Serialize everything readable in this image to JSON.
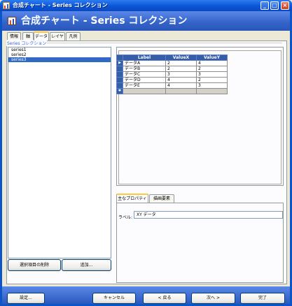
{
  "window": {
    "title": "合成チャート - Series コレクション"
  },
  "header": {
    "title": "合成チャート - Series コレクション"
  },
  "tabs": [
    {
      "label": "情報"
    },
    {
      "label": "軸"
    },
    {
      "label": "データ"
    },
    {
      "label": "レイヤ"
    },
    {
      "label": "凡例"
    }
  ],
  "group": {
    "label": "Series コレクション"
  },
  "series_list": [
    "series1",
    "series2",
    "series3"
  ],
  "series_selected": "series3",
  "series_buttons": {
    "delete": "選択項目の削除",
    "add": "追加..."
  },
  "grid": {
    "headers": [
      "Label",
      "ValueX",
      "ValueY"
    ],
    "rows": [
      [
        "データA",
        "2",
        "4"
      ],
      [
        "データB",
        "2",
        "2"
      ],
      [
        "データC",
        "3",
        "3"
      ],
      [
        "データD",
        "4",
        "2"
      ],
      [
        "データE",
        "4",
        "3"
      ]
    ],
    "current_row_marker": "▶",
    "new_row_marker": "✱"
  },
  "prop_tabs": [
    {
      "label": "主なプロパティ"
    },
    {
      "label": "描画要素"
    }
  ],
  "properties": {
    "label_caption": "ラベル:",
    "label_value": "XY データ"
  },
  "footer": {
    "settings": "設定...",
    "cancel": "キャンセル",
    "back": "< 戻る",
    "next": "次へ >",
    "finish": "完了"
  },
  "colors": {
    "title": "#0a56d6",
    "header_band": "#3362c9",
    "grid_header": "#345ea8",
    "selection": "#316ac5",
    "tab_highlight": "#ffc83c"
  }
}
